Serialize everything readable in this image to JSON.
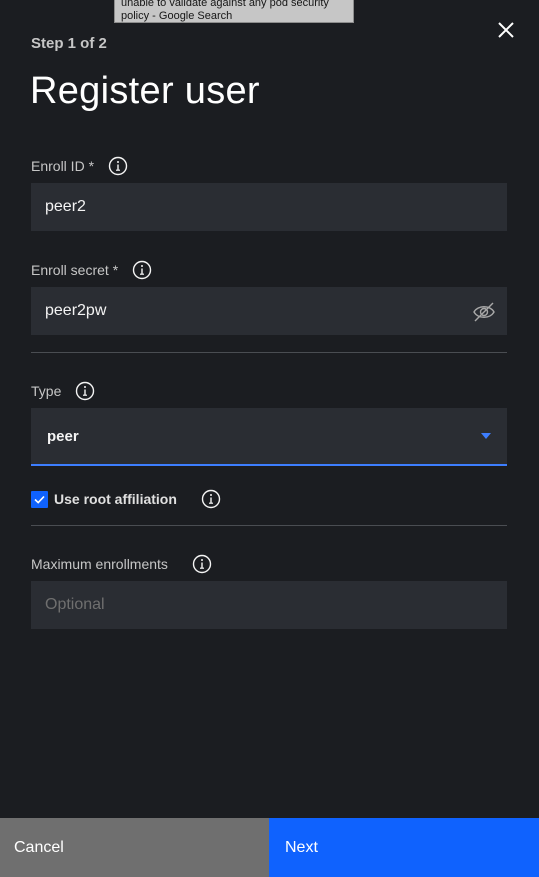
{
  "tooltip": {
    "line1": "unable to validate against any pod security",
    "line2": "policy - Google Search"
  },
  "header": {
    "step": "Step 1 of 2",
    "title": "Register user"
  },
  "form": {
    "enroll_id": {
      "label": "Enroll ID *",
      "value": "peer2"
    },
    "enroll_secret": {
      "label": "Enroll secret *",
      "value": "peer2pw"
    },
    "type": {
      "label": "Type",
      "selected": "peer"
    },
    "root_affiliation": {
      "label": "Use root affiliation",
      "checked": true
    },
    "max_enrollments": {
      "label": "Maximum enrollments",
      "value": "",
      "placeholder": "Optional"
    }
  },
  "footer": {
    "cancel_label": "Cancel",
    "next_label": "Next"
  },
  "colors": {
    "background": "#1b1d21",
    "field_bg": "#2a2d33",
    "accent": "#0f62fe",
    "cancel_bg": "#6f6f6f"
  },
  "icons": [
    "close-icon",
    "info-icon",
    "eye-off-icon",
    "caret-down-icon",
    "checkmark-icon"
  ]
}
